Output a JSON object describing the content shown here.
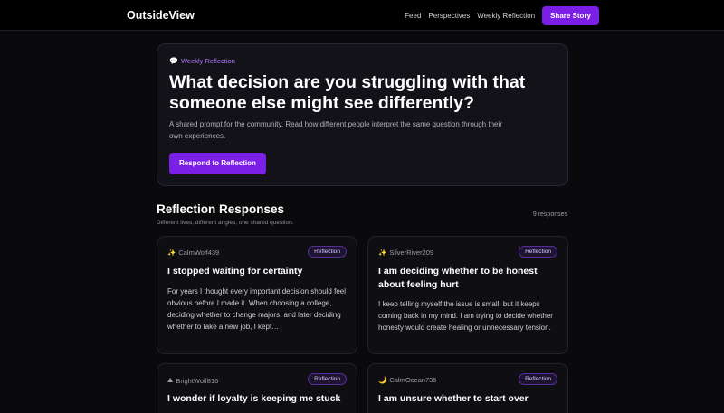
{
  "header": {
    "logo": "OutsideView",
    "nav": [
      "Feed",
      "Perspectives",
      "Weekly Reflection"
    ],
    "cta": "Share Story"
  },
  "hero": {
    "tag": "Weekly Reflection",
    "tag_icon": "speech-bubble-icon",
    "title": "What decision are you struggling with that someone else might see differently?",
    "description": "A shared prompt for the community. Read how different people interpret the same question through their own experiences.",
    "button": "Respond to Reflection"
  },
  "responses": {
    "title": "Reflection Responses",
    "subtitle": "Different lives, different angles, one shared question.",
    "count": "9 responses",
    "cards": [
      {
        "user": "CalmWolf439",
        "icon": "sparkles-icon",
        "glyph": "✨",
        "badge": "Reflection",
        "title": "I stopped waiting for certainty",
        "body": "For years I thought every important decision should feel obvious before I made it. When choosing a college, deciding whether to change majors, and later deciding whether to take a new job, I kept…"
      },
      {
        "user": "SilverRiver209",
        "icon": "sparkles-icon",
        "glyph": "✨",
        "badge": "Reflection",
        "title": "I am deciding whether to be honest about feeling hurt",
        "body": "I keep telling myself the issue is small, but it keeps coming back in my mind. I am trying to decide whether honesty would create healing or unnecessary tension."
      },
      {
        "user": "BrightWolf816",
        "icon": "mountain-icon",
        "glyph": "⛰",
        "badge": "Reflection",
        "title": "I wonder if loyalty is keeping me stuck",
        "body": ""
      },
      {
        "user": "CalmOcean735",
        "icon": "crescent-moon-icon",
        "glyph": "🌙",
        "badge": "Reflection",
        "title": "I am unsure whether to start over",
        "body": ""
      }
    ]
  },
  "colors": {
    "accent": "#7c1fe6",
    "accent_text": "#b37cff",
    "background": "#0a0a0c"
  }
}
